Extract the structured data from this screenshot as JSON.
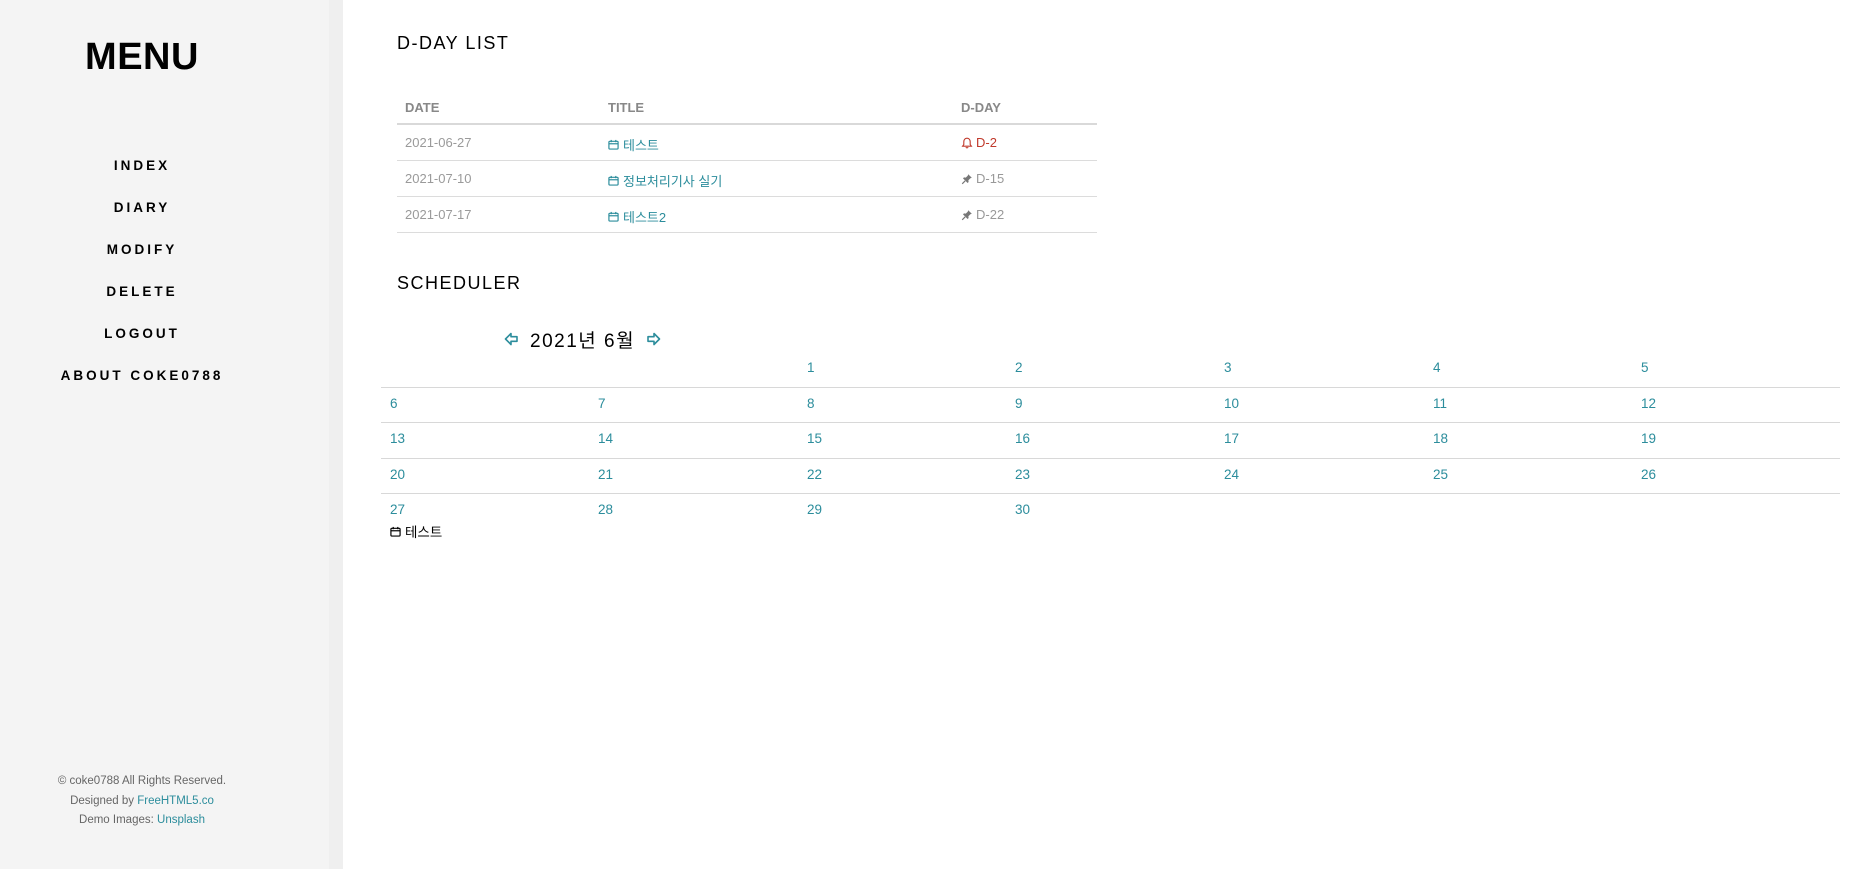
{
  "sidebar": {
    "title": "MENU",
    "items": [
      {
        "label": "INDEX"
      },
      {
        "label": "DIARY"
      },
      {
        "label": "MODIFY"
      },
      {
        "label": "DELETE"
      },
      {
        "label": "LOGOUT"
      },
      {
        "label": "ABOUT COKE0788"
      }
    ],
    "footer": {
      "copyright": "© coke0788 All Rights Reserved.",
      "designed_prefix": "Designed by ",
      "designed_link": "FreeHTML5.co",
      "images_prefix": "Demo Images: ",
      "images_link": "Unsplash"
    }
  },
  "dday": {
    "title": "D-DAY LIST",
    "headers": {
      "date": "DATE",
      "title": "TITLE",
      "dday": "D-DAY"
    },
    "rows": [
      {
        "date": "2021-06-27",
        "title": "테스트",
        "dday": "D-2",
        "icon": "bell-icon",
        "urgent": true
      },
      {
        "date": "2021-07-10",
        "title": "정보처리기사 실기",
        "dday": "D-15",
        "icon": "pin-icon",
        "urgent": false
      },
      {
        "date": "2021-07-17",
        "title": "테스트2",
        "dday": "D-22",
        "icon": "pin-icon",
        "urgent": false
      }
    ]
  },
  "scheduler": {
    "title": "SCHEDULER",
    "month_label": "2021년 6월",
    "weeks": [
      [
        "",
        "",
        "1",
        "2",
        "3",
        "4",
        "5"
      ],
      [
        "6",
        "7",
        "8",
        "9",
        "10",
        "11",
        "12"
      ],
      [
        "13",
        "14",
        "15",
        "16",
        "17",
        "18",
        "19"
      ],
      [
        "20",
        "21",
        "22",
        "23",
        "24",
        "25",
        "26"
      ],
      [
        "27",
        "28",
        "29",
        "30",
        "",
        "",
        ""
      ]
    ],
    "event": {
      "day": "27",
      "label": "테스트"
    }
  },
  "colors": {
    "accent": "#2c8d9c",
    "urgent": "#c0392b",
    "sidebar_bg": "#f4f4f4"
  }
}
